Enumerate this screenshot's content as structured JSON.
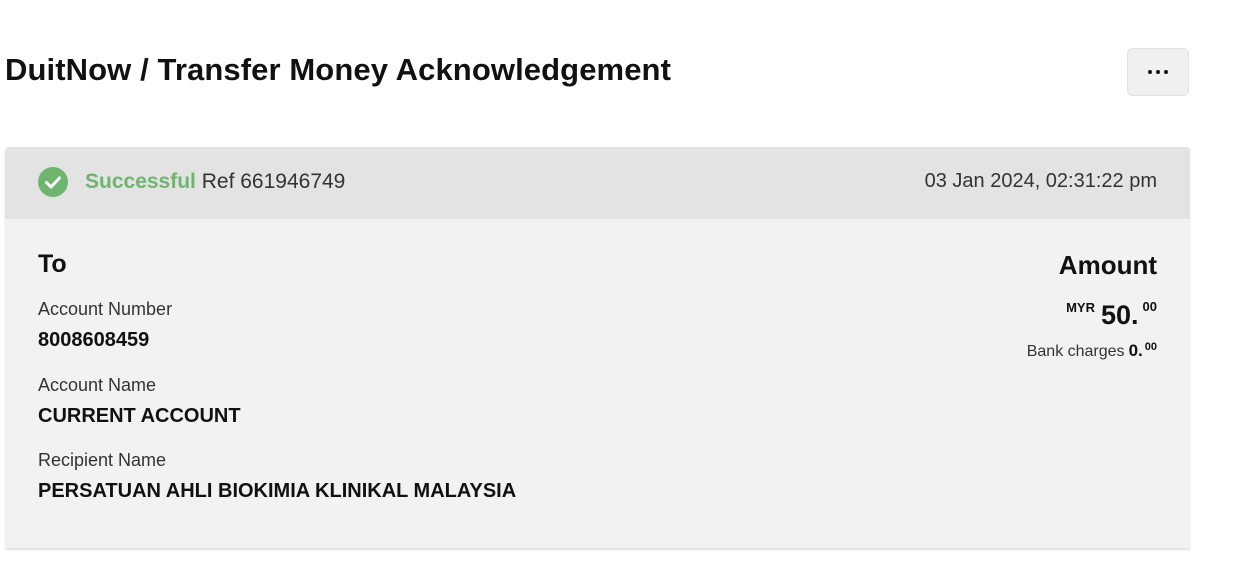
{
  "page": {
    "title": "DuitNow / Transfer Money Acknowledgement",
    "more_button_label": "more options"
  },
  "status": {
    "label": "Successful",
    "ref": "Ref 661946749",
    "timestamp": "03 Jan 2024, 02:31:22 pm",
    "color": "#6fb56f",
    "icon": "check-circle-icon"
  },
  "details": {
    "to_heading": "To",
    "account_number_label": "Account Number",
    "account_number": "8008608459",
    "account_name_label": "Account Name",
    "account_name": "CURRENT ACCOUNT",
    "recipient_name_label": "Recipient Name",
    "recipient_name": "PERSATUAN AHLI BIOKIMIA KLINIKAL MALAYSIA"
  },
  "amount": {
    "heading": "Amount",
    "currency": "MYR",
    "whole": "50.",
    "cents": "00",
    "bank_charges_label": "Bank charges",
    "bank_charges_whole": "0.",
    "bank_charges_cents": "00"
  },
  "footer": {
    "partial_link": ""
  }
}
